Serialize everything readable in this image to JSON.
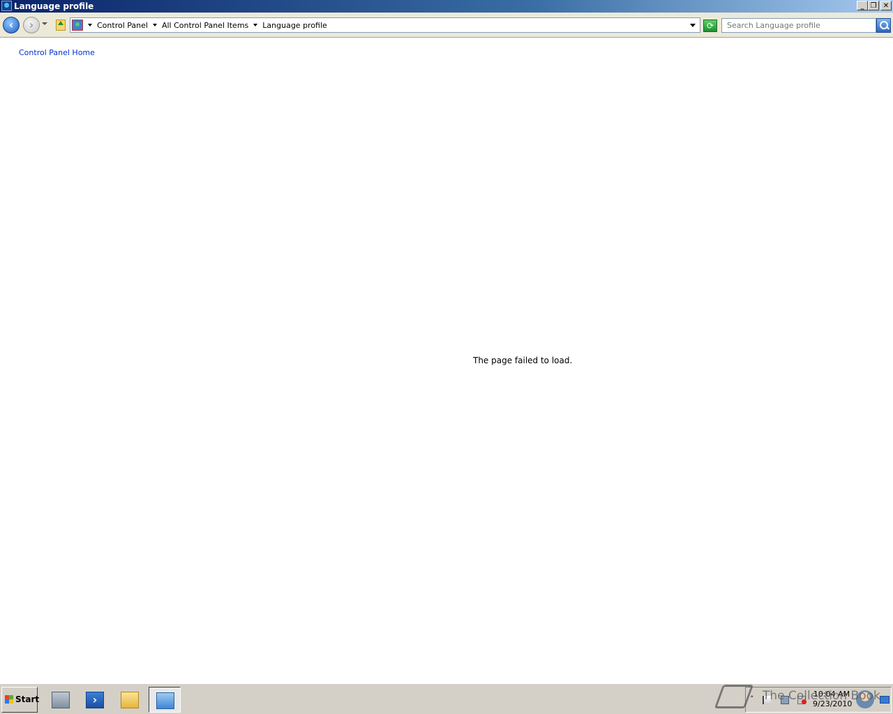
{
  "window": {
    "title": "Language profile",
    "minimize": "_",
    "restore": "❐",
    "close": "✕"
  },
  "address": {
    "breadcrumbs": [
      "Control Panel",
      "All Control Panel Items",
      "Language profile"
    ],
    "search_placeholder": "Search Language profile"
  },
  "content": {
    "home_link": "Control Panel Home",
    "message": "The page failed to load."
  },
  "taskbar": {
    "start_label": "Start",
    "items": [
      "server-manager-icon",
      "powershell-icon",
      "explorer-icon",
      "control-panel-icon"
    ],
    "clock_time": "10:04 AM",
    "clock_date": "9/23/2010"
  },
  "watermark": {
    "text": "The Collection Book"
  },
  "colors": {
    "title_bar": "#0a246a",
    "link": "#0033cc"
  }
}
